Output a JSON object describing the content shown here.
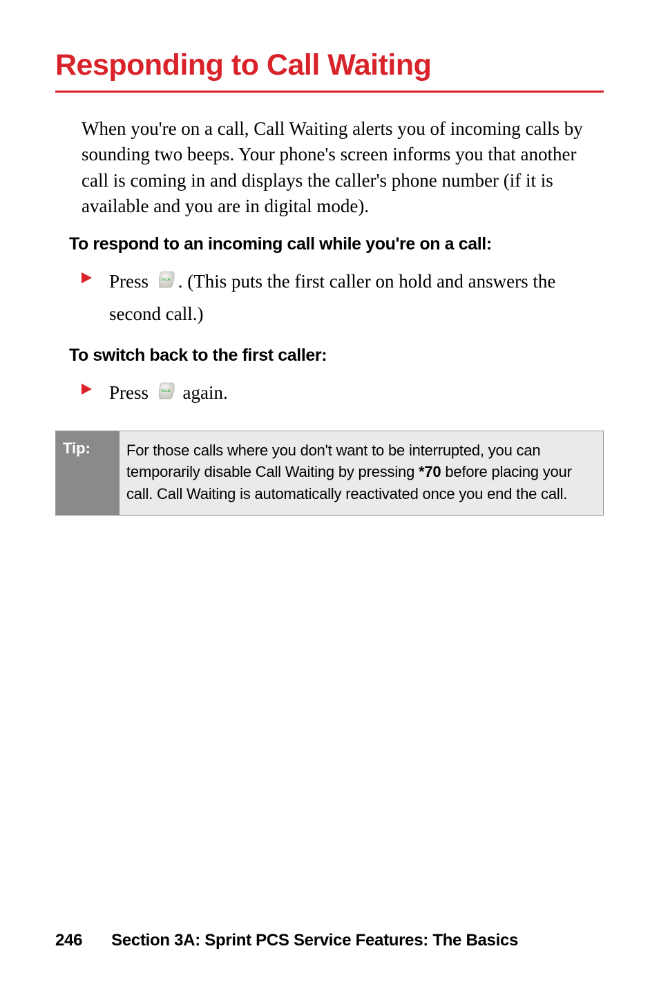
{
  "title": "Responding to Call Waiting",
  "intro": "When you're on a call, Call Waiting alerts you of incoming calls by sounding two beeps. Your phone's screen informs you that another call is coming in and displays the caller's phone number (if it is available and you are in digital mode).",
  "subhead1": "To respond to an incoming call while you're on a call:",
  "step1_a": "Press ",
  "step1_b": ". (This puts the first caller on hold and answers the second call.)",
  "subhead2": "To switch back to the first caller:",
  "step2_a": "Press ",
  "step2_b": " again.",
  "tip": {
    "label": "Tip:",
    "body_a": "For those calls where you don't want to be interrupted, you can temporarily disable Call Waiting by pressing ",
    "body_bold": "*70",
    "body_b": " before placing your call. Call Waiting is automatically reactivated once you end the call."
  },
  "footer": {
    "page": "246",
    "section": "Section 3A: Sprint PCS Service Features: The Basics"
  },
  "icons": {
    "talk_key": "TALK"
  }
}
